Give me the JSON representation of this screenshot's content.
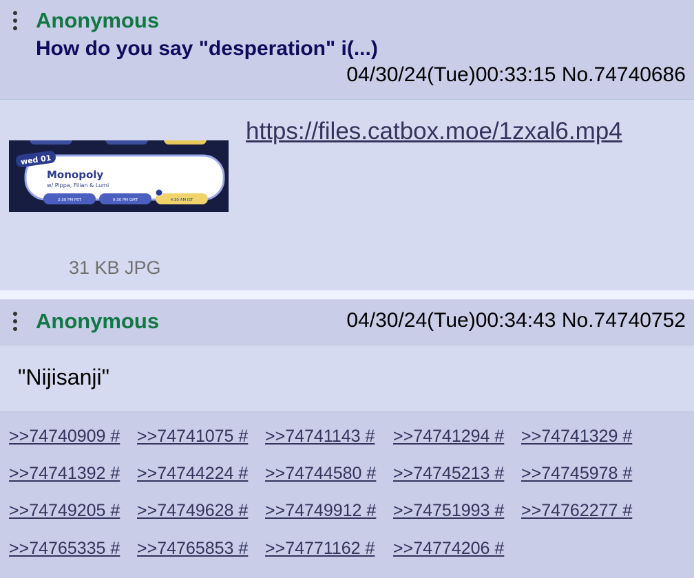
{
  "posts": [
    {
      "name": "Anonymous",
      "subject": "How do you say \"desperation\" i(...)",
      "date": "04/30/24(Tue)00:33:15",
      "number": "No.74740686",
      "file_link": "https://files.catbox.moe/1zxal6.mp4",
      "file_info": "31 KB JPG",
      "thumbnail": {
        "badge": "wed 01",
        "title": "Monopoly",
        "subtitle": "w/ Pippa, Filian & Lumi",
        "times": [
          "2:30 PM PST",
          "9:30 PM GMT",
          "4:30 AM IST"
        ]
      }
    },
    {
      "name": "Anonymous",
      "date": "04/30/24(Tue)00:34:43",
      "number": "No.74740752",
      "comment": "\"Nijisanji\"",
      "replies": [
        ">>74740909 #",
        ">>74741075 #",
        ">>74741143 #",
        ">>74741294 #",
        ">>74741329 #",
        ">>74741392 #",
        ">>74744224 #",
        ">>74744580 #",
        ">>74745213 #",
        ">>74745978 #",
        ">>74749205 #",
        ">>74749628 #",
        ">>74749912 #",
        ">>74751993 #",
        ">>74762277 #",
        ">>74765335 #",
        ">>74765853 #",
        ">>74771162 #",
        ">>74774206 #"
      ]
    }
  ],
  "colors": {
    "name": "#117743",
    "subject": "#0f0c5d",
    "link": "#34345c",
    "post_bg": "#d6daf0",
    "header_bg": "#c9cde8"
  }
}
